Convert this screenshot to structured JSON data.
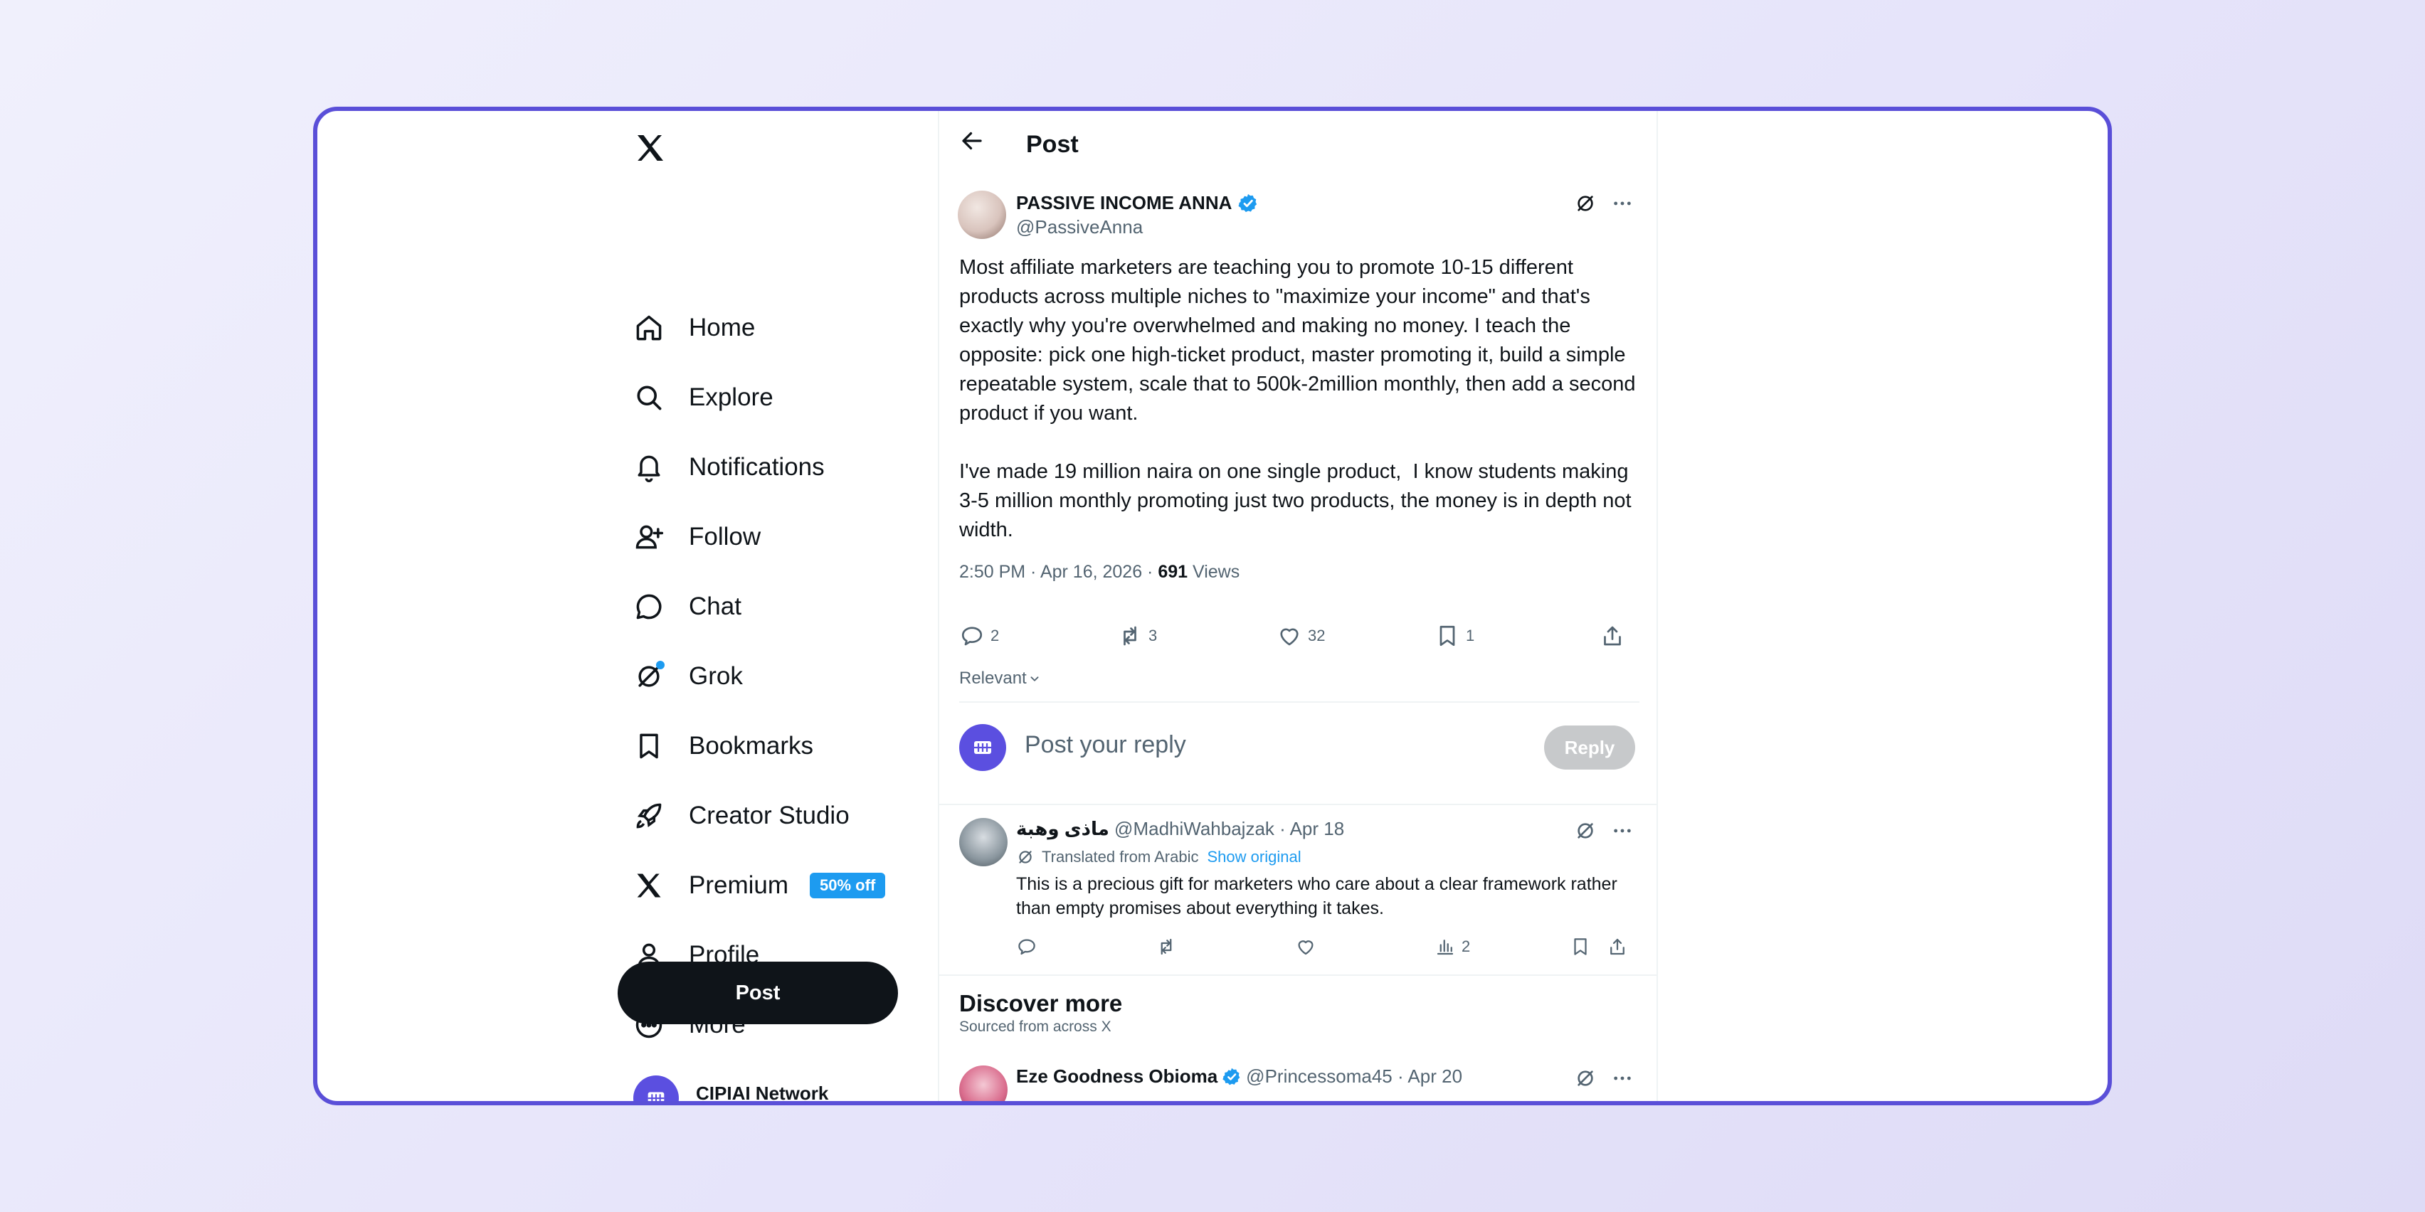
{
  "sidebar": {
    "items": [
      {
        "label": "Home",
        "icon": "home-icon"
      },
      {
        "label": "Explore",
        "icon": "search-icon"
      },
      {
        "label": "Notifications",
        "icon": "bell-icon"
      },
      {
        "label": "Follow",
        "icon": "follow-icon"
      },
      {
        "label": "Chat",
        "icon": "chat-icon"
      },
      {
        "label": "Grok",
        "icon": "grok-icon"
      },
      {
        "label": "Bookmarks",
        "icon": "bookmark-icon"
      },
      {
        "label": "Creator Studio",
        "icon": "rocket-icon"
      },
      {
        "label": "Premium",
        "icon": "x-icon",
        "badge": "50% off"
      },
      {
        "label": "Profile",
        "icon": "person-icon"
      },
      {
        "label": "More",
        "icon": "more-circle-icon"
      }
    ],
    "post_button": "Post",
    "account_name": "CIPIAI Network"
  },
  "header": {
    "title": "Post"
  },
  "post": {
    "author_name": "PASSIVE INCOME ANNA",
    "author_handle": "@PassiveAnna",
    "text": "Most affiliate marketers are teaching you to promote 10-15 different products across multiple niches to \"maximize your income\" and that's exactly why you're overwhelmed and making no money. I teach the opposite: pick one high-ticket product, master promoting it, build a simple repeatable system, scale that to 500k-2million monthly, then add a second product if you want.\n\nI've made 19 million naira on one single product,  I know students making 3-5 million monthly promoting just two products, the money is in depth not width.",
    "timestamp": "2:50 PM · Apr 16, 2026 · ",
    "views_count": "691",
    "views_label": " Views",
    "replies": "2",
    "reposts": "3",
    "likes": "32",
    "bookmarks": "1"
  },
  "sort": {
    "label": "Relevant"
  },
  "reply_box": {
    "placeholder": "Post your reply",
    "button": "Reply"
  },
  "comment": {
    "name": "ماذى وهبة",
    "handle_date": " @MadhiWahbajzak · Apr 18",
    "translated": "Translated from Arabic",
    "show_original": "Show original",
    "text": "This is a precious gift for marketers who care about a clear framework rather than empty promises about everything it takes.",
    "views": "2"
  },
  "discover": {
    "title": "Discover more",
    "subtitle": "Sourced from across X",
    "first_name": "Eze Goodness Obioma",
    "first_handle_date": " @Princessoma45 · Apr 20"
  },
  "colors": {
    "accent": "#1d9bf0",
    "frame": "#5a4fd8",
    "text": "#0f1419",
    "muted": "#536471"
  }
}
